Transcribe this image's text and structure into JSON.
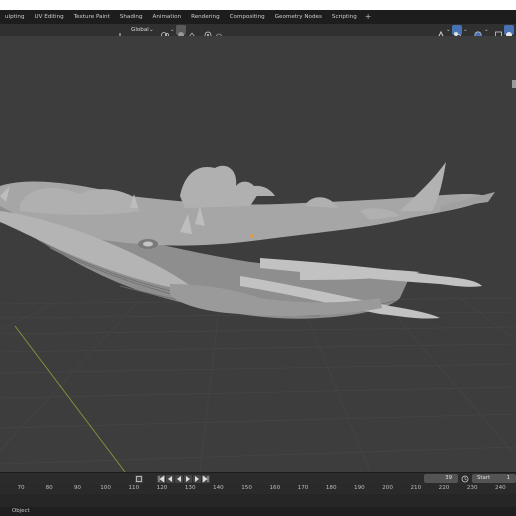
{
  "workspace_tabs": [
    "ulpting",
    "UV Editing",
    "Texture Paint",
    "Shading",
    "Animation",
    "Rendering",
    "Compositing",
    "Geometry Nodes",
    "Scripting"
  ],
  "add_tab_label": "+",
  "viewport_header": {
    "orientation_label": "Global"
  },
  "timeline": {
    "current_frame": "39",
    "start_label": "Start",
    "start_value": "1",
    "ruler_ticks": [
      "70",
      "80",
      "90",
      "100",
      "110",
      "120",
      "130",
      "140",
      "150",
      "160",
      "170",
      "180",
      "190",
      "200",
      "210",
      "220",
      "230",
      "240"
    ]
  },
  "status_bar": {
    "mode_label": "Object"
  },
  "icons": [
    "orientation-icon",
    "link-icon",
    "snap-icon",
    "proportional-icon",
    "gizmo-icon",
    "overlay-icon",
    "shading-solid-icon",
    "play-icon",
    "jump-start-icon",
    "jump-end-icon",
    "keyframe-prev-icon",
    "keyframe-next-icon",
    "record-icon",
    "clock-icon",
    "mouse-icon"
  ],
  "colors": {
    "viewport_bg": "#3d3d3d",
    "grid_line": "#4a4a4a",
    "y_axis": "#7f9a3a",
    "model": "#a8a8a8",
    "accent_blue": "#4772b3"
  }
}
